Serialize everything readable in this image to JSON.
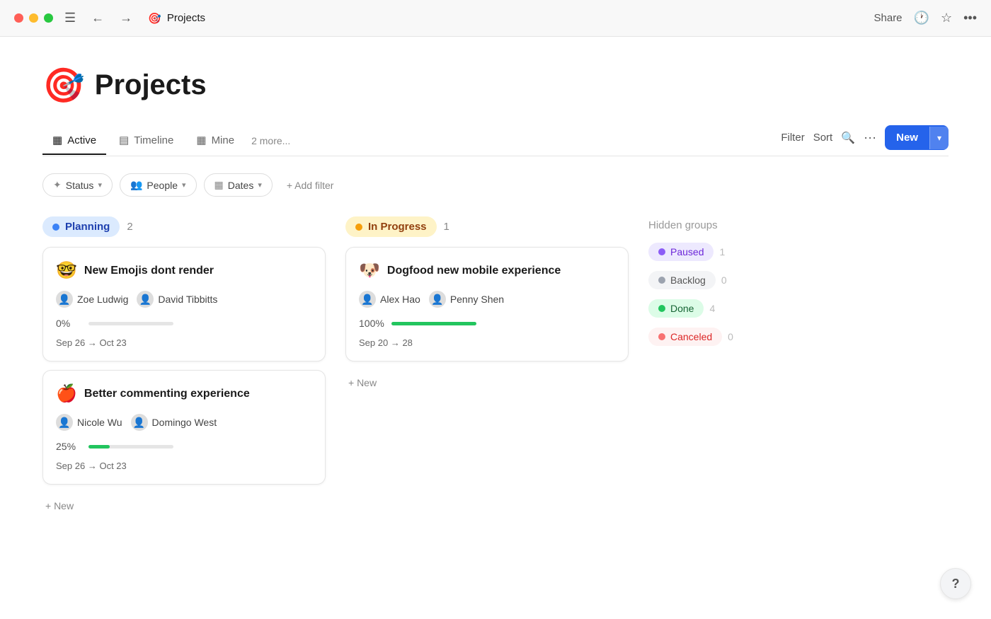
{
  "titlebar": {
    "app_title": "Projects",
    "share_label": "Share",
    "nav_back": "←",
    "nav_forward": "→"
  },
  "page": {
    "icon": "🎯",
    "title": "Projects"
  },
  "tabs": {
    "items": [
      {
        "id": "active",
        "label": "Active",
        "icon": "▦",
        "active": true
      },
      {
        "id": "timeline",
        "label": "Timeline",
        "icon": "▤"
      },
      {
        "id": "mine",
        "label": "Mine",
        "icon": "▦"
      }
    ],
    "more_label": "2 more...",
    "filter_label": "Filter",
    "sort_label": "Sort",
    "new_label": "New"
  },
  "filters": {
    "status_label": "Status",
    "people_label": "People",
    "dates_label": "Dates",
    "add_filter_label": "+ Add filter"
  },
  "columns": [
    {
      "id": "planning",
      "label": "Planning",
      "dot_class": "dot-planning",
      "badge_class": "badge-planning",
      "count": 2,
      "cards": [
        {
          "id": "card1",
          "emoji": "🤓",
          "title": "New Emojis dont  render",
          "people": [
            {
              "name": "Zoe Ludwig",
              "avatar": "👤"
            },
            {
              "name": "David Tibbitts",
              "avatar": "👤"
            }
          ],
          "progress": 0,
          "progress_label": "0%",
          "progress_class": "fill-0",
          "date_start": "Sep 26",
          "date_end": "Oct 23"
        },
        {
          "id": "card2",
          "emoji": "🍎",
          "title": "Better commenting experience",
          "people": [
            {
              "name": "Nicole Wu",
              "avatar": "👤"
            },
            {
              "name": "Domingo West",
              "avatar": "👤"
            }
          ],
          "progress": 25,
          "progress_label": "25%",
          "progress_class": "fill-25",
          "date_start": "Sep 26",
          "date_end": "Oct 23"
        }
      ],
      "add_label": "+ New"
    },
    {
      "id": "inprogress",
      "label": "In Progress",
      "dot_class": "dot-inprogress",
      "badge_class": "badge-inprogress",
      "count": 1,
      "cards": [
        {
          "id": "card3",
          "emoji": "🐶",
          "title": "Dogfood new mobile experience",
          "people": [
            {
              "name": "Alex Hao",
              "avatar": "👤"
            },
            {
              "name": "Penny Shen",
              "avatar": "👤"
            }
          ],
          "progress": 100,
          "progress_label": "100%",
          "progress_class": "fill-100",
          "date_start": "Sep 20",
          "date_end": "28"
        }
      ],
      "add_label": "+ New"
    }
  ],
  "hidden_groups": {
    "title": "Hidden groups",
    "items": [
      {
        "id": "paused",
        "label": "Paused",
        "dot_class": "dot-paused",
        "badge_class": "badge-paused",
        "count": 1
      },
      {
        "id": "backlog",
        "label": "Backlog",
        "dot_class": "dot-backlog",
        "badge_class": "badge-backlog",
        "count": 0
      },
      {
        "id": "done",
        "label": "Done",
        "dot_class": "dot-done",
        "badge_class": "badge-done",
        "count": 4
      },
      {
        "id": "canceled",
        "label": "Canceled",
        "dot_class": "dot-canceled",
        "badge_class": "badge-canceled",
        "count": 0
      }
    ]
  },
  "help": "?"
}
